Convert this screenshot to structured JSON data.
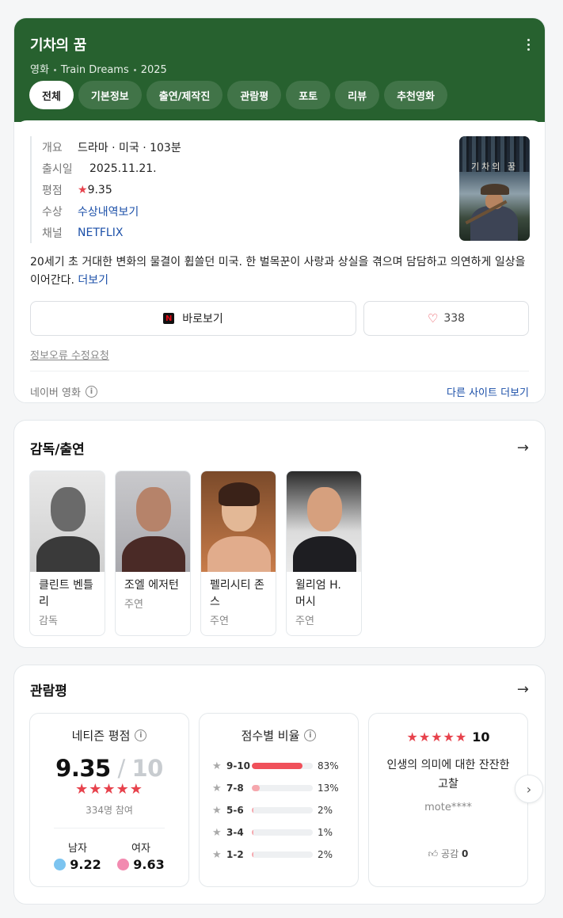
{
  "header": {
    "title": "기차의 꿈",
    "sub_type": "영화",
    "sub_original": "Train Dreams",
    "sub_year": "2025",
    "tabs": [
      "전체",
      "기본정보",
      "출연/제작진",
      "관람평",
      "포토",
      "리뷰",
      "추천영화"
    ]
  },
  "info": {
    "overview_label": "개요",
    "overview_value": "드라마 · 미국 · 103분",
    "release_label": "출시일",
    "release_value": "2025.11.21.",
    "rating_label": "평점",
    "rating_star": "★",
    "rating_value": "9.35",
    "award_label": "수상",
    "award_value": "수상내역보기",
    "channel_label": "채널",
    "channel_value": "NETFLIX",
    "poster_title": "기차의 꿈"
  },
  "synopsis": {
    "text": "20세기 초 거대한 변화의 물결이 휩쓸던 미국. 한 벌목꾼이 사랑과 상실을 겪으며 담담하고 의연하게 일상을 이어간다. ",
    "more": "더보기"
  },
  "actions": {
    "watch_icon": "N",
    "watch_label": "바로보기",
    "like_count": "338",
    "report_label": "정보오류 수정요청",
    "source_label": "네이버 영화",
    "more_sites": "다른 사이트 더보기"
  },
  "cast": {
    "title": "감독/출연",
    "people": [
      {
        "name": "클린트 벤틀리",
        "role": "감독"
      },
      {
        "name": "조엘 에저턴",
        "role": "주연"
      },
      {
        "name": "펠리시티 존스",
        "role": "주연"
      },
      {
        "name": "윌리엄 H. 머시",
        "role": "주연"
      }
    ]
  },
  "reviews": {
    "title": "관람평",
    "netizen_label": "네티즌 평점",
    "score": "9.35",
    "score_max": "10",
    "participants": "334명 참여",
    "male_label": "남자",
    "male_score": "9.22",
    "female_label": "여자",
    "female_score": "9.63",
    "dist_label": "점수별 비율",
    "distribution": [
      {
        "range": "9-10",
        "pct": "83%",
        "value": 83
      },
      {
        "range": "7-8",
        "pct": "13%",
        "value": 13
      },
      {
        "range": "5-6",
        "pct": "2%",
        "value": 2
      },
      {
        "range": "3-4",
        "pct": "1%",
        "value": 1
      },
      {
        "range": "1-2",
        "pct": "2%",
        "value": 2
      }
    ],
    "top_review": {
      "score": "10",
      "text": "인생의 의미에 대한 잔잔한 고찰",
      "user": "mote****",
      "like_label": "공감",
      "like_count": "0"
    }
  },
  "colors": {
    "header_bg": "#27612f",
    "link": "#1b4fa8",
    "star": "#e7424c"
  }
}
